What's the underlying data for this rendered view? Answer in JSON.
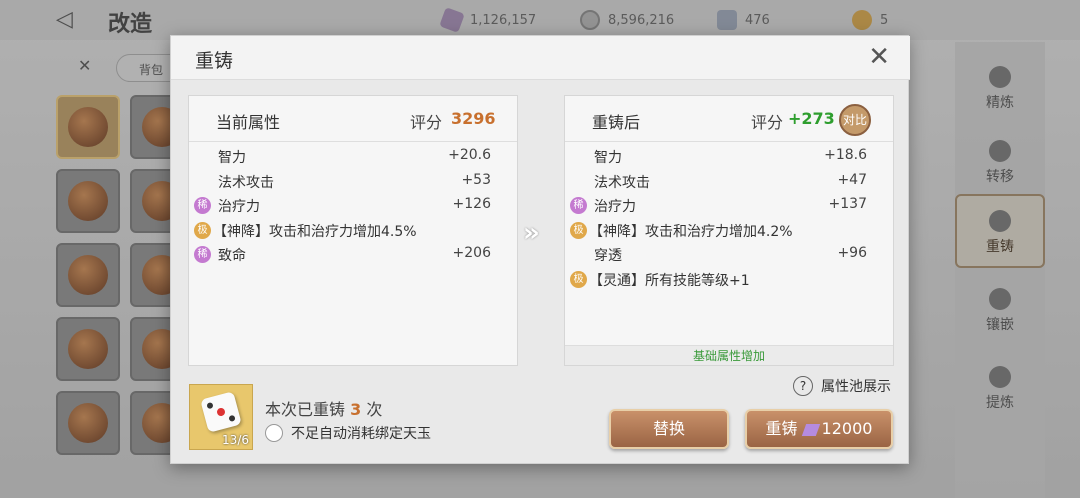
{
  "background": {
    "title": "改造",
    "currencies": [
      {
        "icon": "crystal-icon",
        "value": "1,126,157"
      },
      {
        "icon": "coin-icon",
        "value": "8,596,216"
      },
      {
        "icon": "shield-token-icon",
        "value": "476"
      },
      {
        "icon": "gold-coin-icon",
        "value": "5"
      }
    ],
    "filter_label": "背包",
    "nav": [
      {
        "label": "精炼",
        "icon": "refine-icon"
      },
      {
        "label": "转移",
        "icon": "transfer-icon"
      },
      {
        "label": "重铸",
        "icon": "reforge-icon",
        "active": true
      },
      {
        "label": "镶嵌",
        "icon": "inlay-icon"
      },
      {
        "label": "提炼",
        "icon": "extract-icon"
      }
    ]
  },
  "modal": {
    "title": "重铸",
    "current": {
      "title": "当前属性",
      "score_label": "评分",
      "score": "3296",
      "attrs": [
        {
          "name": "智力",
          "value": "+20.6",
          "badge": ""
        },
        {
          "name": "法术攻击",
          "value": "+53",
          "badge": ""
        },
        {
          "name": "治疗力",
          "value": "+126",
          "badge": "稀"
        },
        {
          "name": "【神降】攻击和治疗力增加4.5%",
          "value": "",
          "badge": "极"
        },
        {
          "name": "致命",
          "value": "+206",
          "badge": "稀"
        }
      ]
    },
    "after": {
      "title": "重铸后",
      "score_label": "评分",
      "score": "+273",
      "compare_label": "对比",
      "attrs": [
        {
          "name": "智力",
          "value": "+18.6",
          "badge": ""
        },
        {
          "name": "法术攻击",
          "value": "+47",
          "badge": ""
        },
        {
          "name": "治疗力",
          "value": "+137",
          "badge": "稀"
        },
        {
          "name": "【神降】攻击和治疗力增加4.2%",
          "value": "",
          "badge": "极"
        },
        {
          "name": "穿透",
          "value": "+96",
          "badge": ""
        },
        {
          "name": "【灵通】所有技能等级+1",
          "value": "",
          "badge": "极"
        }
      ],
      "footer_note": "基础属性增加"
    },
    "dice_count": "13/6",
    "reforge_text_prefix": "本次已重铸",
    "reforge_count": "3",
    "reforge_text_suffix": "次",
    "auto_consume_label": "不足自动消耗绑定天玉",
    "pool_label": "属性池展示",
    "replace_label": "替换",
    "reforge_button_label": "重铸",
    "reforge_cost": "12000"
  }
}
